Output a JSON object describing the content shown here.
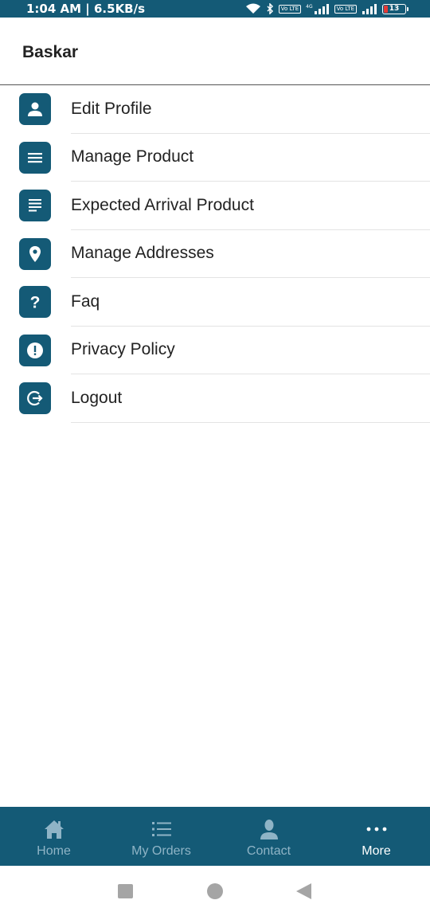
{
  "status_bar": {
    "time": "1:04 AM | 6.5KB/s",
    "volte1": "Vo LTE",
    "network1": "4G",
    "volte2": "Vo LTE",
    "battery": "13"
  },
  "header": {
    "username": "Baskar"
  },
  "menu": {
    "items": [
      {
        "label": "Edit Profile",
        "icon": "person-icon"
      },
      {
        "label": "Manage Product",
        "icon": "menu-lines-icon"
      },
      {
        "label": "Expected Arrival Product",
        "icon": "notes-icon"
      },
      {
        "label": "Manage Addresses",
        "icon": "location-pin-icon"
      },
      {
        "label": "Faq",
        "icon": "question-icon"
      },
      {
        "label": "Privacy Policy",
        "icon": "exclamation-icon"
      },
      {
        "label": "Logout",
        "icon": "logout-icon"
      }
    ]
  },
  "bottom_nav": {
    "items": [
      {
        "label": "Home",
        "icon": "home-icon",
        "active": false
      },
      {
        "label": "My Orders",
        "icon": "list-icon",
        "active": false
      },
      {
        "label": "Contact",
        "icon": "contact-icon",
        "active": false
      },
      {
        "label": "More",
        "icon": "more-dots-icon",
        "active": true
      }
    ]
  },
  "colors": {
    "primary": "#145a76",
    "inactive_nav": "#8fb4c6",
    "text": "#222222"
  }
}
